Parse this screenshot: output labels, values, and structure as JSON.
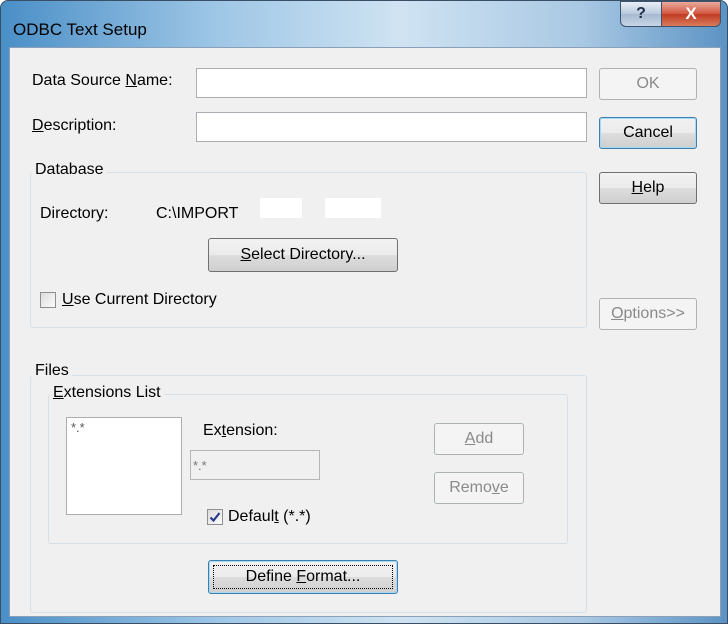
{
  "window": {
    "title": "ODBC Text Setup"
  },
  "titlebar": {
    "help_label": "?",
    "close_label": "X"
  },
  "form": {
    "dsn_label": "Data Source Name:",
    "dsn_value": "",
    "desc_label": "Description:",
    "desc_value": ""
  },
  "buttons": {
    "ok": "OK",
    "cancel": "Cancel",
    "help": "Help",
    "options": "Options>>"
  },
  "database": {
    "group_label": "Database",
    "directory_label": "Directory:",
    "directory_value": "C:\\IMPORT",
    "select_directory": "Select Directory...",
    "use_current_directory": "Use Current Directory",
    "use_current_checked": false
  },
  "files": {
    "group_label": "Files",
    "extensions_group_label": "Extensions List",
    "list_items": [
      "*.*"
    ],
    "extension_label": "Extension:",
    "extension_value": "*.*",
    "add": "Add",
    "remove": "Remove",
    "default_label": "Default (*.*)",
    "default_checked": true,
    "define_format": "Define Format..."
  }
}
